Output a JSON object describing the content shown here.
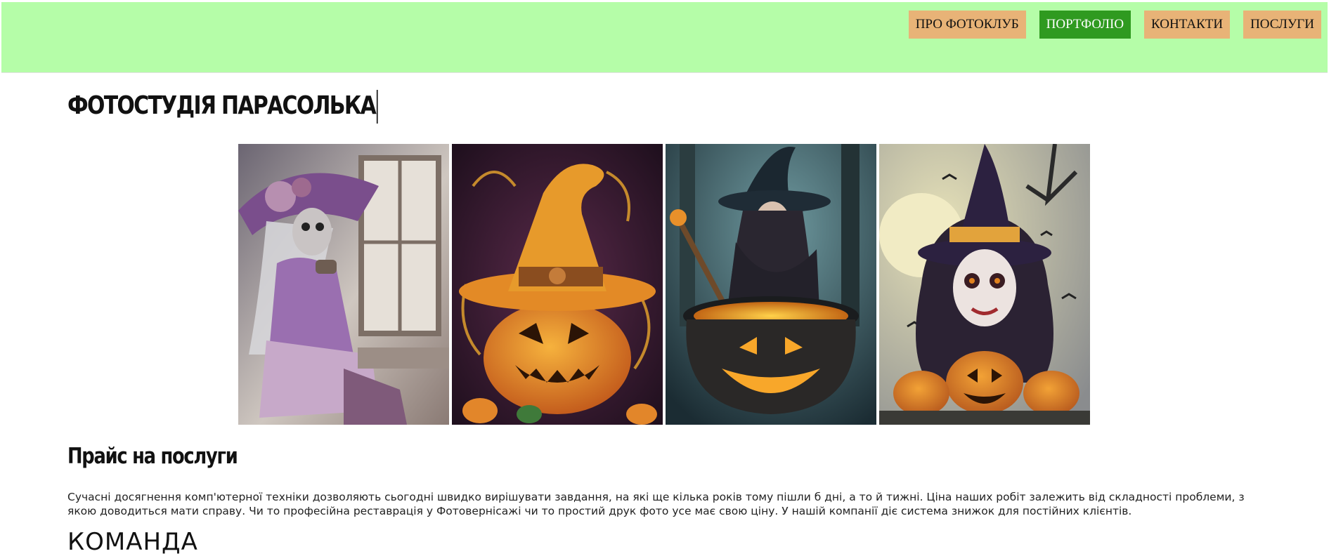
{
  "nav": {
    "items": [
      {
        "label": "ПРО ФОТОКЛУБ",
        "active": false
      },
      {
        "label": "ПОРТФОЛІО",
        "active": true
      },
      {
        "label": "КОНТАКТИ",
        "active": false
      },
      {
        "label": "ПОСЛУГИ",
        "active": false
      }
    ]
  },
  "page_title": "ФОТОСТУДІЯ ПАРАСОЛЬКА",
  "price_section": {
    "title": "Прайс на послуги",
    "text": "Сучасні досягнення комп'ютерної техніки дозволяють сьогодні швидко вирішувати завдання, на які ще кілька років тому пішли б дні, а то й тижні. Ціна наших робіт залежить від складності проблеми, з якою доводиться мати справу. Чи то професійна реставрація у Фотовернісажі чи то простий друк фото усе має свою ціну. У нашій компанії діє система знижок для постійних клієнтів."
  },
  "team_title": "КОМАНДА",
  "colors": {
    "header_bg": "#b5fda8",
    "nav_button_bg": "#e8b377",
    "nav_button_active_bg": "#2f9a20"
  }
}
